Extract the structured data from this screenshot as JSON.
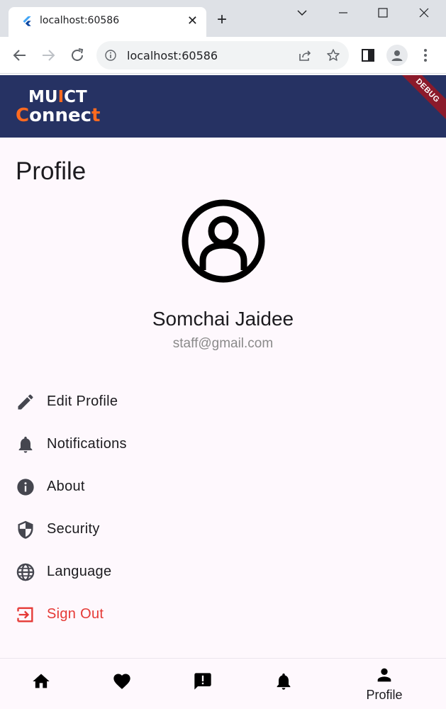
{
  "browser": {
    "tab_title": "localhost:60586",
    "tab_close": "✕",
    "new_tab": "+",
    "url": "localhost:60586"
  },
  "app": {
    "logo_line1_a": "MU",
    "logo_line1_b": "I",
    "logo_line1_c": "CT",
    "logo_line2_a": "C",
    "logo_line2_b": "onnec",
    "logo_line2_c": "t",
    "debug_banner": "DEBUG",
    "brand_color": "#263263",
    "accent_color": "#ff6a1f"
  },
  "profile": {
    "title": "Profile",
    "name": "Somchai Jaidee",
    "email": "staff@gmail.com"
  },
  "menu": [
    {
      "label": "Edit Profile",
      "icon": "pencil-icon"
    },
    {
      "label": "Notifications",
      "icon": "bell-icon"
    },
    {
      "label": "About",
      "icon": "info-icon"
    },
    {
      "label": "Security",
      "icon": "shield-icon"
    },
    {
      "label": "Language",
      "icon": "globe-icon"
    },
    {
      "label": "Sign Out",
      "icon": "logout-icon",
      "color": "#e53935"
    }
  ],
  "bottom_nav": [
    {
      "icon": "home-icon",
      "label": ""
    },
    {
      "icon": "heart-icon",
      "label": ""
    },
    {
      "icon": "report-icon",
      "label": ""
    },
    {
      "icon": "bell-icon",
      "label": ""
    },
    {
      "icon": "person-icon",
      "label": "Profile",
      "active": true
    }
  ]
}
